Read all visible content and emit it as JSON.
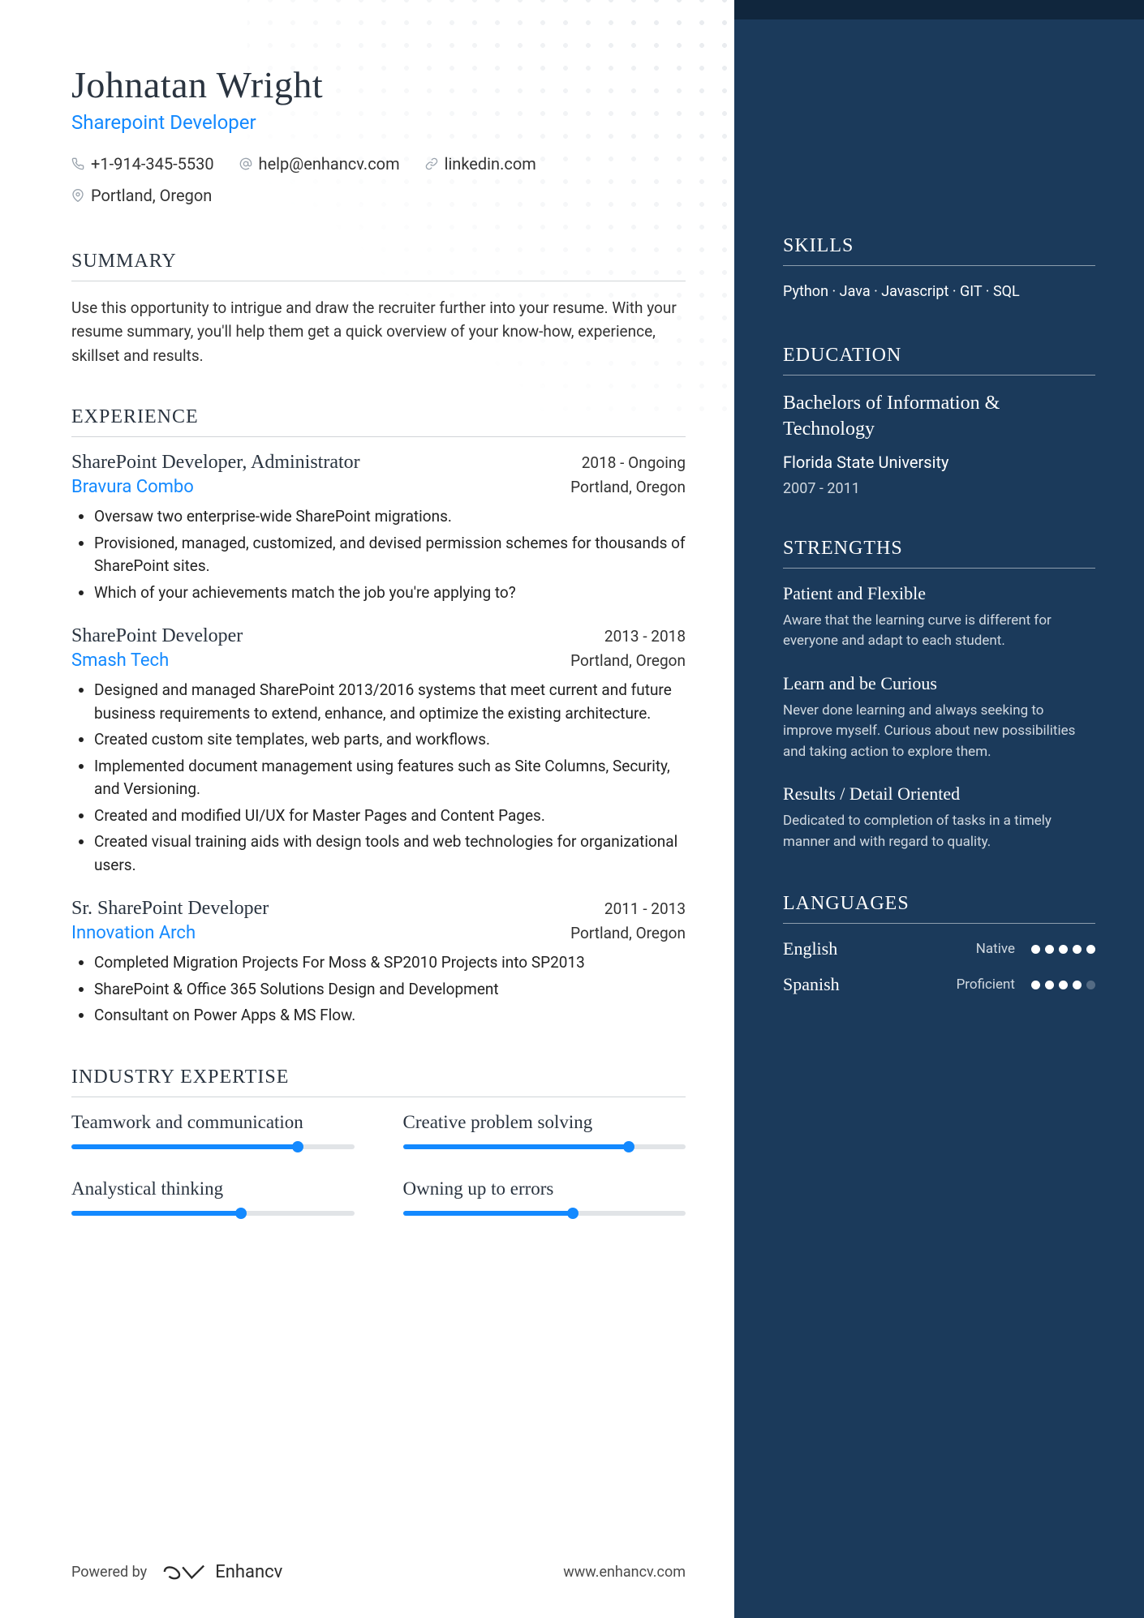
{
  "header": {
    "name": "Johnatan Wright",
    "title": "Sharepoint Developer",
    "phone": "+1-914-345-5530",
    "email": "help@enhancv.com",
    "linkedin": "linkedin.com",
    "location": "Portland, Oregon"
  },
  "sections": {
    "summary_title": "SUMMARY",
    "experience_title": "EXPERIENCE",
    "expertise_title": "INDUSTRY EXPERTISE",
    "skills_title": "SKILLS",
    "education_title": "EDUCATION",
    "strengths_title": "STRENGTHS",
    "languages_title": "LANGUAGES"
  },
  "summary": "Use this opportunity to intrigue and draw the recruiter further into your resume. With your resume summary, you'll help them get a quick overview of your know-how, experience, skillset and results.",
  "experience": [
    {
      "title": "SharePoint Developer, Administrator",
      "dates": "2018 - Ongoing",
      "company": "Bravura Combo",
      "location": "Portland, Oregon",
      "bullets": [
        "Oversaw two enterprise-wide SharePoint migrations.",
        "Provisioned, managed, customized, and devised permission schemes for thousands of SharePoint sites.",
        "Which of your achievements match the job you're applying to?"
      ]
    },
    {
      "title": "SharePoint Developer",
      "dates": "2013 - 2018",
      "company": "Smash Tech",
      "location": "Portland, Oregon",
      "bullets": [
        "Designed and managed SharePoint 2013/2016 systems that meet current and future business requirements to extend, enhance, and optimize the existing architecture.",
        "Created custom site templates, web parts, and workflows.",
        "Implemented document management using features such as Site Columns, Security, and Versioning.",
        "Created and modified UI/UX for Master Pages and Content Pages.",
        "Created visual training aids with design tools and web technologies for organizational users."
      ]
    },
    {
      "title": "Sr. SharePoint Developer",
      "dates": "2011 - 2013",
      "company": "Innovation Arch",
      "location": "Portland, Oregon",
      "bullets": [
        "Completed Migration Projects For Moss & SP2010 Projects into SP2013",
        "SharePoint & Office 365 Solutions Design and Development",
        "Consultant on Power Apps & MS Flow."
      ]
    }
  ],
  "expertise": [
    {
      "label": "Teamwork and communication",
      "pct": 80
    },
    {
      "label": "Creative problem solving",
      "pct": 80
    },
    {
      "label": "Analystical thinking",
      "pct": 60
    },
    {
      "label": "Owning up to errors",
      "pct": 60
    }
  ],
  "skills": "Python · Java · Javascript · GIT · SQL",
  "education": {
    "degree": "Bachelors of Information & Technology",
    "school": "Florida State University",
    "dates": "2007 - 2011"
  },
  "strengths": [
    {
      "title": "Patient and Flexible",
      "desc": "Aware that the learning curve is different for everyone and adapt to each student."
    },
    {
      "title": "Learn and be Curious",
      "desc": "Never done learning and always seeking to improve myself. Curious about new possibilities and taking action to explore them."
    },
    {
      "title": "Results / Detail Oriented",
      "desc": "Dedicated to completion of tasks in a timely manner and with regard to quality."
    }
  ],
  "languages": [
    {
      "name": "English",
      "level": "Native",
      "dots": 5
    },
    {
      "name": "Spanish",
      "level": "Proficient",
      "dots": 4
    }
  ],
  "footer": {
    "powered": "Powered by",
    "brand": "Enhancv",
    "url": "www.enhancv.com"
  }
}
